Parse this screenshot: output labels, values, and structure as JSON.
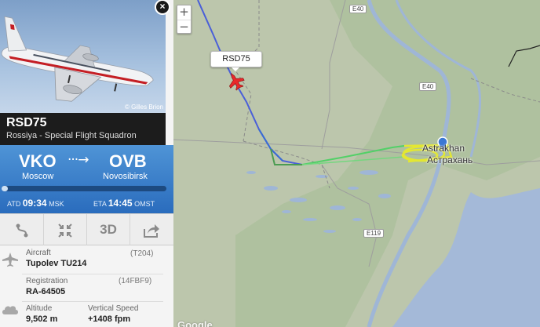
{
  "map": {
    "zoom_in": "+",
    "zoom_out": "−",
    "flight_label": "RSD75",
    "roads": [
      "E40",
      "E40",
      "E119"
    ],
    "city_latin": "Astrakhan",
    "city_cyrillic": "Астрахань",
    "watermark": "Google"
  },
  "panel": {
    "close": "×",
    "photo_credit": "© Gilles Brion",
    "callsign": "RSD75",
    "airline": "Rossiya - Special Flight Squadron",
    "origin_code": "VKO",
    "origin_city": "Moscow",
    "destination_code": "OVB",
    "destination_city": "Novosibirsk",
    "arrow": "···→",
    "progress_fraction": 0.04,
    "atd_label": "ATD",
    "atd_time": "09:34",
    "atd_zone": "MSK",
    "eta_label": "ETA",
    "eta_time": "14:45",
    "eta_zone": "OMST",
    "tools": {
      "route_icon": "route-icon",
      "collapse_icon": "collapse-icon",
      "three_d": "3D",
      "share_icon": "share-icon"
    },
    "aircraft_label": "Aircraft",
    "aircraft_code": "(T204)",
    "aircraft_value": "Tupolev TU214",
    "registration_label": "Registration",
    "registration_code": "(14FBF9)",
    "registration_value": "RA-64505",
    "altitude_label": "Altitude",
    "altitude_value": "9,502 m",
    "vspeed_label": "Vertical Speed",
    "vspeed_value": "+1408 fpm"
  }
}
